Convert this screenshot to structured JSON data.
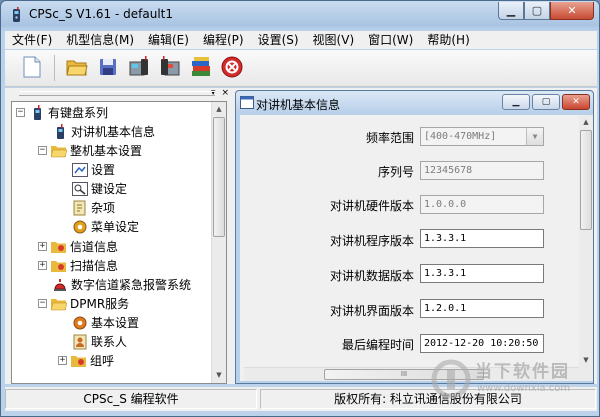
{
  "window": {
    "title": "CPSc_S V1.61 - default1",
    "controls": {
      "minimize": "▁",
      "maximize": "▢",
      "close": "✕"
    }
  },
  "menubar": {
    "items": [
      "文件(F)",
      "机型信息(M)",
      "编辑(E)",
      "编程(P)",
      "设置(S)",
      "视图(V)",
      "窗口(W)",
      "帮助(H)"
    ]
  },
  "toolbar": {
    "buttons": [
      "new-document-icon",
      "open-folder-icon",
      "save-disk-icon",
      "read-radio-icon",
      "write-radio-icon",
      "books-icon",
      "stop-icon"
    ]
  },
  "tree_panel": {
    "pin_label": "▾",
    "close_label": "×",
    "items": [
      {
        "label": "有键盘系列",
        "icon": "radio-icon",
        "expander": "−"
      },
      {
        "label": "对讲机基本信息",
        "icon": "radio-icon"
      },
      {
        "label": "整机基本设置",
        "icon": "folder-open-icon",
        "expander": "−"
      },
      {
        "label": "设置",
        "icon": "settings-icon"
      },
      {
        "label": "键设定",
        "icon": "key-icon"
      },
      {
        "label": "杂项",
        "icon": "misc-icon"
      },
      {
        "label": "菜单设定",
        "icon": "gear-icon"
      },
      {
        "label": "信道信息",
        "icon": "channel-icon",
        "expander": "+"
      },
      {
        "label": "扫描信息",
        "icon": "scan-icon",
        "expander": "+"
      },
      {
        "label": "数字信道紧急报警系统",
        "icon": "alarm-icon"
      },
      {
        "label": "DPMR服务",
        "icon": "folder-open-icon",
        "expander": "−"
      },
      {
        "label": "基本设置",
        "icon": "gear-icon"
      },
      {
        "label": "联系人",
        "icon": "contacts-icon"
      },
      {
        "label": "组呼",
        "icon": "group-call-icon",
        "expander": "+"
      }
    ]
  },
  "child_window": {
    "title": "对讲机基本信息",
    "fields": [
      {
        "label": "频率范围",
        "value": "[400-470MHz]",
        "type": "combo"
      },
      {
        "label": "序列号",
        "value": "12345678",
        "type": "text"
      },
      {
        "label": "对讲机硬件版本",
        "value": "1.0.0.0",
        "type": "text"
      },
      {
        "label": "对讲机程序版本",
        "value": "1.3.3.1",
        "type": "text-active"
      },
      {
        "label": "对讲机数据版本",
        "value": "1.3.3.1",
        "type": "text-active"
      },
      {
        "label": "对讲机界面版本",
        "value": "1.2.0.1",
        "type": "text-active"
      },
      {
        "label": "最后编程时间",
        "value": "2012-12-20 10:20:50",
        "type": "text-active"
      }
    ],
    "hscroll_grip": "III"
  },
  "statusbar": {
    "left": "CPSc_S 编程软件",
    "right": "版权所有: 科立讯通信股份有限公司"
  },
  "watermark": {
    "text": "当下软件园",
    "url": "www.downxia.com"
  },
  "colors": {
    "title_gradient_top": "#c9dcf0",
    "title_gradient_bottom": "#a9c4e2",
    "close_button": "#c84a32",
    "client_bg": "#f0f0f0"
  }
}
